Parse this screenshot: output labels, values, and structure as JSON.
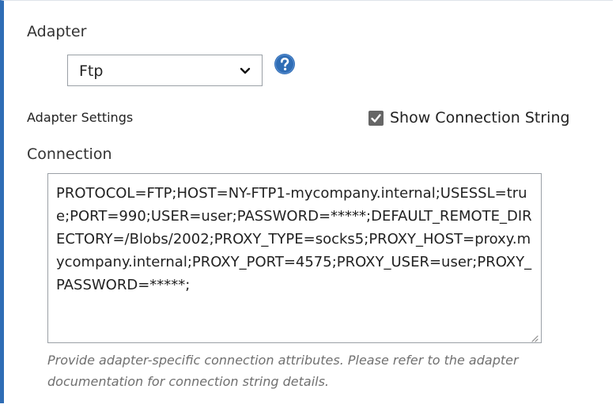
{
  "adapter": {
    "label": "Adapter",
    "selected_value": "Ftp",
    "help_icon": "question-circle-icon",
    "dropdown_icon": "chevron-down-icon"
  },
  "adapter_settings": {
    "label": "Adapter Settings",
    "show_connection_string": {
      "label": "Show Connection String",
      "checked": true
    }
  },
  "connection": {
    "label": "Connection",
    "value": "PROTOCOL=FTP;HOST=NY-FTP1-mycompany.internal;USESSL=true;PORT=990;USER=user;PASSWORD=*****;DEFAULT_REMOTE_DIRECTORY=/Blobs/2002;PROXY_TYPE=socks5;PROXY_HOST=proxy.mycompany.internal;PROXY_PORT=4575;PROXY_USER=user;PROXY_PASSWORD=*****;",
    "help_text": "Provide adapter-specific connection attributes. Please refer to the adapter documentation for connection string details."
  },
  "colors": {
    "accent_border": "#2f6db5",
    "help_icon": "#2f6db5",
    "checkbox": "#666666",
    "help_text": "#707070"
  }
}
